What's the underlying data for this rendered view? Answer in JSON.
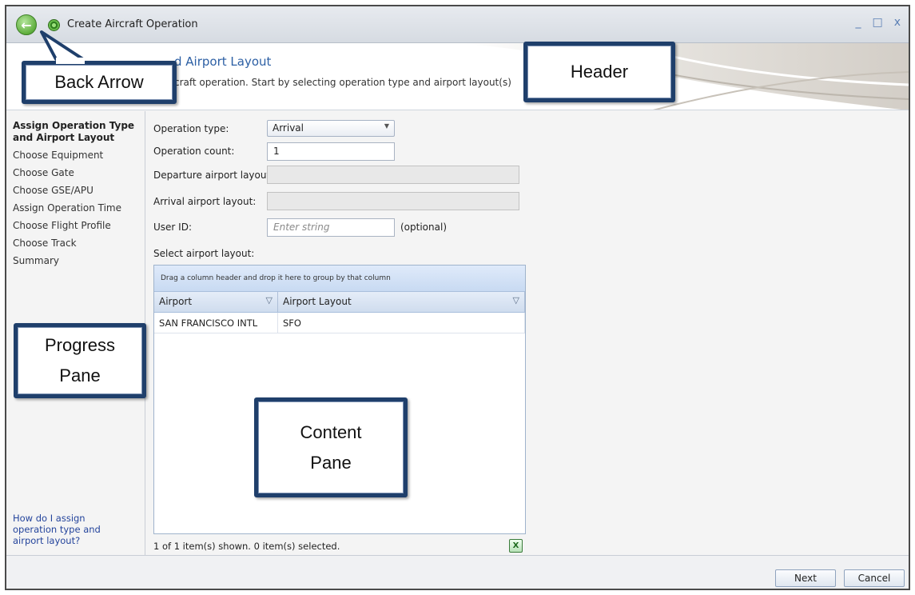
{
  "window": {
    "title": "Create Aircraft Operation",
    "controls": [
      "_",
      "□",
      "x"
    ]
  },
  "header": {
    "title": "d Airport Layout",
    "description": "craft operation. Start by selecting operation type and airport layout(s)"
  },
  "progress_pane": {
    "steps": [
      "Assign Operation Type and Airport Layout",
      "Choose Equipment",
      "Choose Gate",
      "Choose GSE/APU",
      "Assign Operation Time",
      "Choose Flight Profile",
      "Choose Track",
      "Summary"
    ],
    "active_step": 0,
    "help_link": "How do I assign operation type and airport layout?"
  },
  "form": {
    "operation_type_label": "Operation type:",
    "operation_type_value": "Arrival",
    "operation_count_label": "Operation count:",
    "operation_count_value": "1",
    "departure_layout_label": "Departure airport layout:",
    "departure_layout_value": "",
    "arrival_layout_label": "Arrival airport layout:",
    "arrival_layout_value": "",
    "user_id_label": "User ID:",
    "user_id_placeholder": "Enter string",
    "user_id_optional": "(optional)",
    "select_layout_label": "Select airport layout:"
  },
  "grid": {
    "group_hint": "Drag a column header and drop it here to group by that column",
    "columns": [
      "Airport",
      "Airport Layout"
    ],
    "rows": [
      [
        "SAN FRANCISCO INTL",
        "SFO"
      ]
    ],
    "status": "1 of 1 item(s) shown. 0 item(s) selected.",
    "export_icon": "excel-export-icon"
  },
  "footer": {
    "next_label": "Next",
    "cancel_label": "Cancel"
  },
  "callouts": {
    "back_arrow": "Back Arrow",
    "header": "Header",
    "progress_pane_line1": "Progress",
    "progress_pane_line2": "Pane",
    "content_pane_line1": "Content",
    "content_pane_line2": "Pane"
  },
  "colors": {
    "accent_blue": "#2c5fa4",
    "callout_border": "#1f3f6b",
    "back_arrow_green": "#5fae3d",
    "link_blue": "#24449c"
  }
}
